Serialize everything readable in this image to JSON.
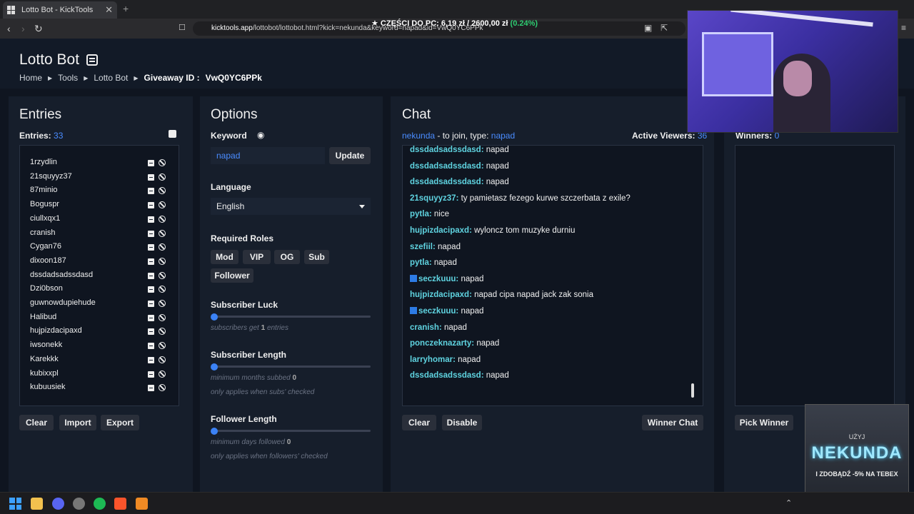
{
  "browser": {
    "tab_title": "Lotto Bot - KickTools",
    "url_host": "kicktools.app",
    "url_path": "/lottobot/lottobot.html?kick=nekunda&keyword=napad&id=VwQ0YC6PPk",
    "ticker": {
      "label": "★ CZĘŚCI DO PC:",
      "current": "6,19 zł",
      "goal": "/ 2600,00 zł",
      "pct": "(0.24%)"
    }
  },
  "header": {
    "title": "Lotto Bot",
    "breadcrumbs": [
      "Home",
      "Tools",
      "Lotto Bot"
    ],
    "giveaway_label": "Giveaway ID :",
    "giveaway_id": "VwQ0YC6PPk"
  },
  "entries": {
    "title": "Entries",
    "count_label": "Entries:",
    "count": "33",
    "items": [
      "1rzydlin",
      "21squyyz37",
      "87minio",
      "Boguspr",
      "ciullxqx1",
      "cranish",
      "Cygan76",
      "dixoon187",
      "dssdadsadssdasd",
      "Dzi0bson",
      "guwnowdupiehude",
      "Halibud",
      "hujpizdacipaxd",
      "iwsonekk",
      "Karekkk",
      "kubixxpl",
      "kubuusiek"
    ],
    "buttons": {
      "clear": "Clear",
      "import": "Import",
      "export": "Export"
    }
  },
  "options": {
    "title": "Options",
    "keyword_label": "Keyword",
    "keyword_value": "napad",
    "update": "Update",
    "language_label": "Language",
    "language_value": "English",
    "roles_label": "Required Roles",
    "roles": [
      "Mod",
      "VIP",
      "OG",
      "Sub",
      "Follower"
    ],
    "sub_luck_label": "Subscriber Luck",
    "sub_luck_hint_a": "subscribers get",
    "sub_luck_value": "1",
    "sub_luck_hint_b": "entries",
    "sub_length_label": "Subscriber Length",
    "sub_length_hint": "minimum months subbed",
    "sub_length_value": "0",
    "sub_length_note": "only applies when subs' checked",
    "follower_length_label": "Follower Length",
    "follower_length_hint": "minimum days followed",
    "follower_length_value": "0",
    "follower_length_note": "only applies when followers' checked"
  },
  "chat": {
    "title": "Chat",
    "channel": "nekunda",
    "join_text": "- to join, type:",
    "keyword": "napad",
    "viewers_label": "Active Viewers:",
    "viewers": "36",
    "messages": [
      {
        "user": "dssdadsadssdasd:",
        "text": "napad",
        "badge": false
      },
      {
        "user": "dssdadsadssdasd:",
        "text": "napad",
        "badge": false
      },
      {
        "user": "dssdadsadssdasd:",
        "text": "napad",
        "badge": false
      },
      {
        "user": "21squyyz37:",
        "text": "ty pamietasz fezego kurwe szczerbata z exile?",
        "badge": false
      },
      {
        "user": "pytla:",
        "text": "nice",
        "badge": false
      },
      {
        "user": "hujpizdacipaxd:",
        "text": "wyloncz tom muzyke durniu",
        "badge": false
      },
      {
        "user": "szefiil:",
        "text": "napad",
        "badge": false
      },
      {
        "user": "pytla:",
        "text": "napad",
        "badge": false
      },
      {
        "user": "seczkuuu:",
        "text": "napad",
        "badge": true
      },
      {
        "user": "hujpizdacipaxd:",
        "text": "napad cipa napad jack zak sonia",
        "badge": false
      },
      {
        "user": "seczkuuu:",
        "text": "napad",
        "badge": true
      },
      {
        "user": "cranish:",
        "text": "napad",
        "badge": false
      },
      {
        "user": "ponczeknazarty:",
        "text": "napad",
        "badge": false
      },
      {
        "user": "larryhomar:",
        "text": "napad",
        "badge": false
      },
      {
        "user": "dssdadsadssdasd:",
        "text": "napad",
        "badge": false
      }
    ],
    "buttons": {
      "clear": "Clear",
      "disable": "Disable",
      "winner_chat": "Winner Chat"
    }
  },
  "winners": {
    "label": "Winners:",
    "count": "0",
    "pick": "Pick Winner"
  },
  "ad": {
    "line1": "UŻYJ",
    "brand": "NEKUNDA",
    "line2": "I ZDOBĄDŹ -5% NA TEBEX"
  }
}
